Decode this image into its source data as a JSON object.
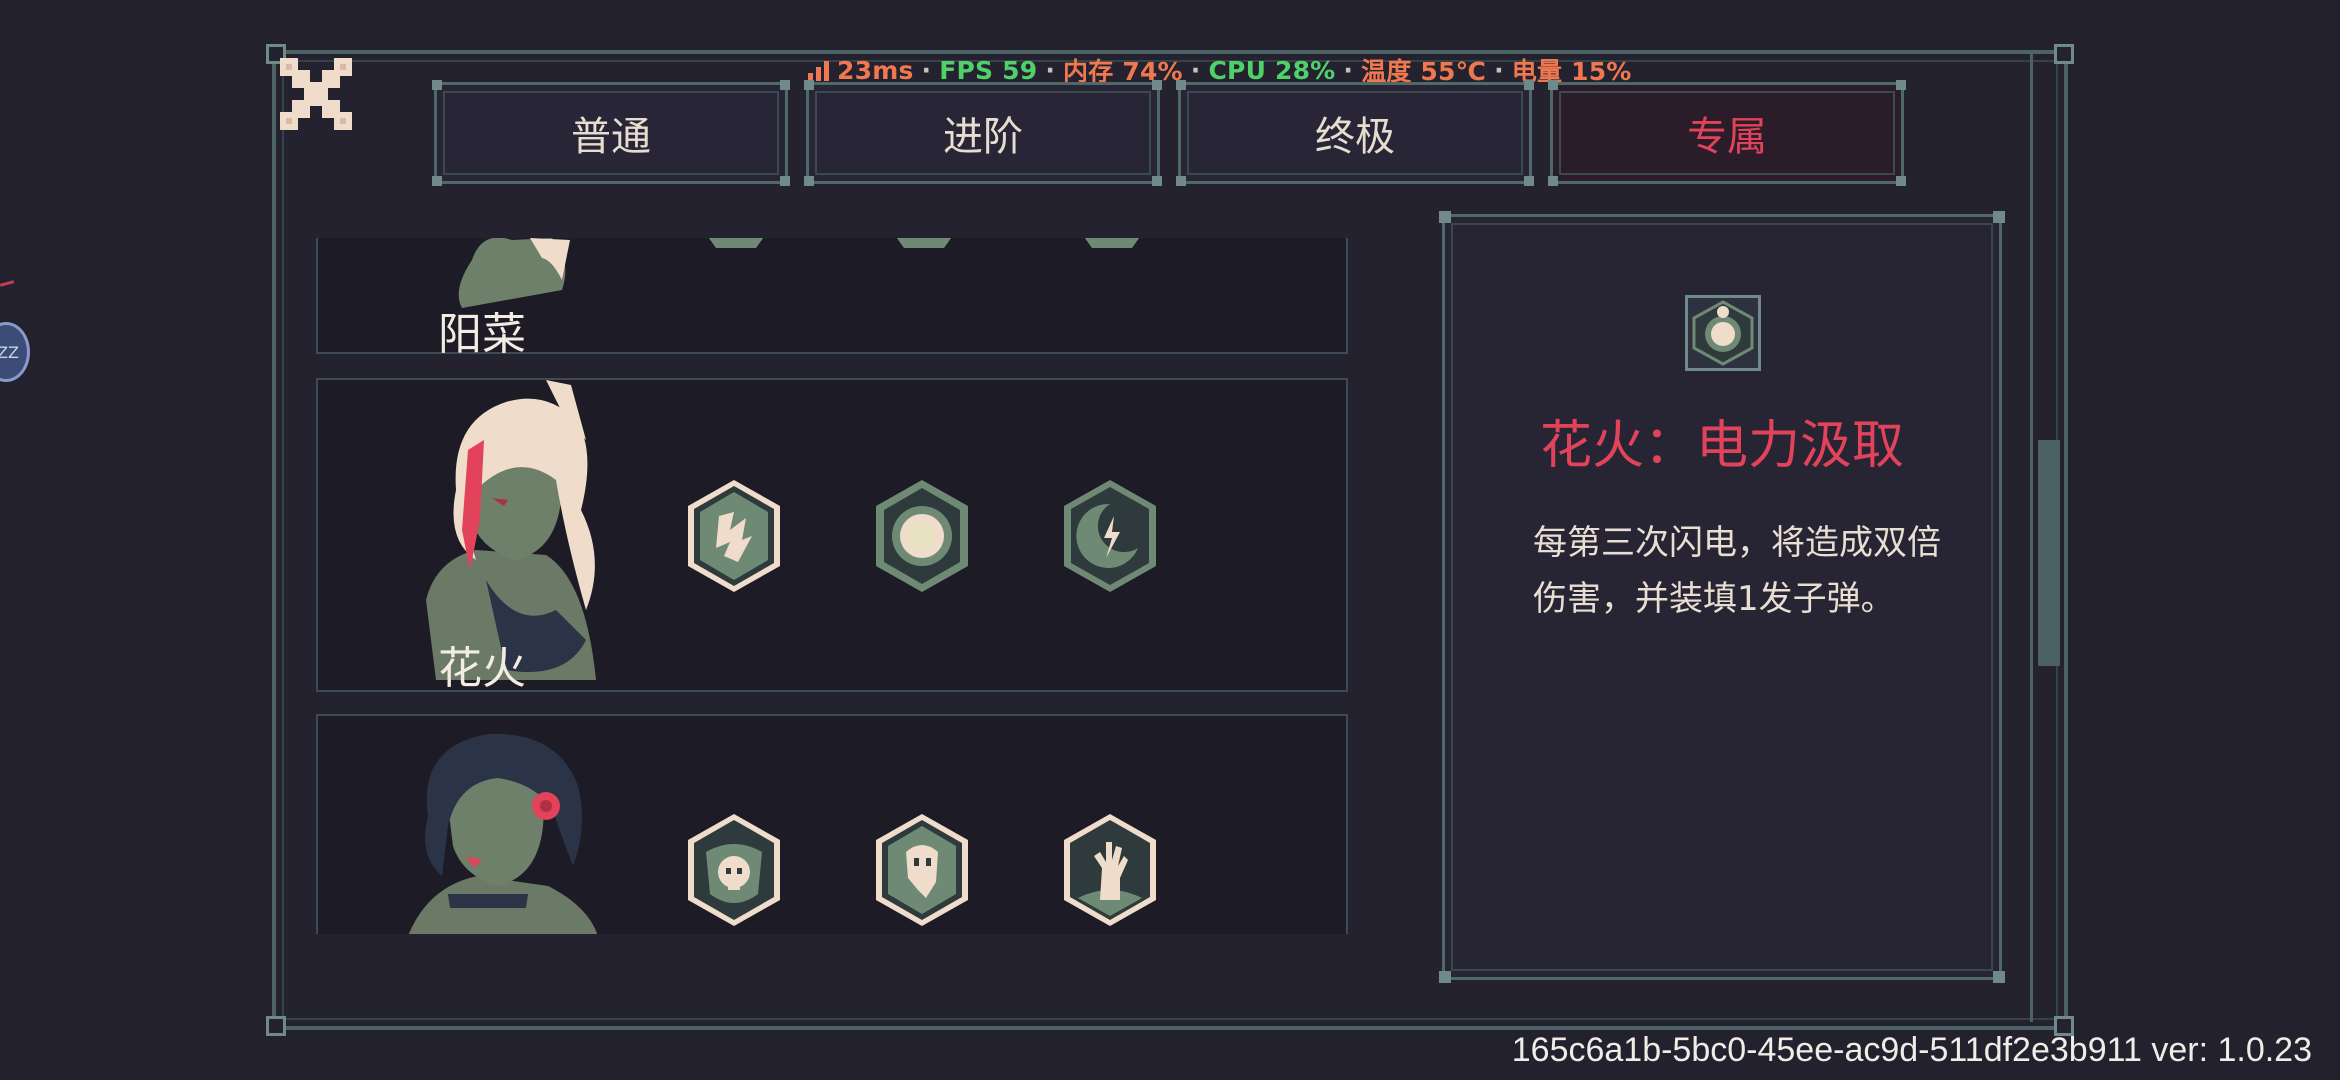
{
  "status_bar": {
    "ping": "23ms",
    "fps": "FPS 59",
    "memory": "内存 74%",
    "cpu": "CPU 28%",
    "temperature": "温度 55℃",
    "battery": "电量 15%",
    "separator": "·"
  },
  "side_bubble": {
    "label": "ZZ"
  },
  "tabs": [
    {
      "label": "普通",
      "active": false
    },
    {
      "label": "进阶",
      "active": false
    },
    {
      "label": "终极",
      "active": false
    },
    {
      "label": "专属",
      "active": true
    }
  ],
  "characters": [
    {
      "name": "阳菜"
    },
    {
      "name": "花火"
    },
    {
      "name": ""
    }
  ],
  "detail": {
    "title": "花火：电力汲取",
    "description": "每第三次闪电，将造成双倍伤害，并装填1发子弹。"
  },
  "footer": {
    "build": "165c6a1b-5bc0-45ee-ac9d-511df2e3b911 ver: 1.0.23"
  },
  "colors": {
    "accent": "#e2435a",
    "frame": "#4f6868",
    "icon_green": "#6f8a74",
    "icon_cream": "#f0dccb"
  }
}
